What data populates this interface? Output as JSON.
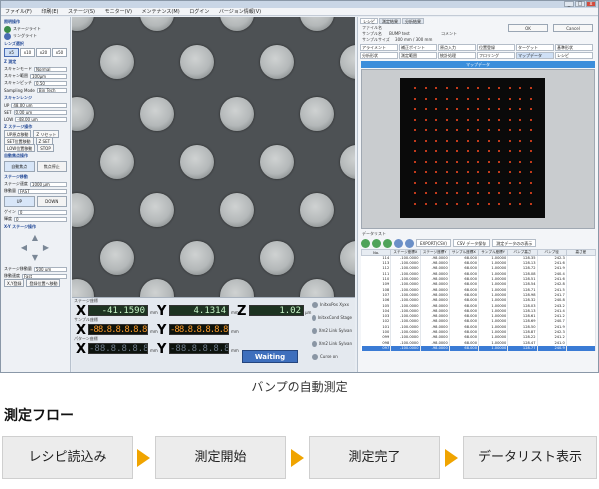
{
  "app": {
    "menu": [
      "ファイル(F)",
      "印刷(E)",
      "ステージ(S)",
      "モニター(V)",
      "メンテナンス(M)",
      "ログイン",
      "バージョン情報(V)"
    ],
    "window_controls": [
      "_",
      "□",
      "x"
    ]
  },
  "left": {
    "illumination_title": "照明操作",
    "illumination_items": [
      "ステージライト",
      "リングライト"
    ],
    "lens_title": "レンズ選択",
    "lens_options": [
      "x5",
      "x10",
      "x20",
      "x50"
    ],
    "lens_selected": "x5",
    "z_title": "Z 測定",
    "scan_mode_label": "スキャンモード",
    "scan_mode_value": "Normal",
    "scan_range_label": "スキャン範囲",
    "scan_range_value": "100μm",
    "scan_pitch_label": "スキャンピッチ",
    "scan_pitch_value": "0.50",
    "sampling_label": "Sampling Mode",
    "sampling_value": "Bin Tech",
    "limits_title": "スキャンレンジ",
    "limits_up": "UP",
    "limits_set": "SET",
    "limits_low": "LOW",
    "limits_up_val": "48.00 um",
    "limits_set_val": "0.00 um",
    "limits_low_val": "-48.00 um",
    "z_stage_title": "Z ステージ操作",
    "btn_up_origin": "UP原点移動",
    "btn_z_reset": "Z リセット",
    "btn_set_origin": "SET位置移動",
    "btn_z_set": "Z SET",
    "btn_low_origin": "LOW位置移動",
    "btn_stop": "STOP",
    "autofocus_title": "自動焦点操作",
    "btn_auto_focus": "自動焦点",
    "btn_focus_stop": "焦点停止",
    "stage_title": "ステージ移動",
    "stage_speed_label": "ステージ速度",
    "stage_speed_value": "1000 μm",
    "move_amount_label": "移動量",
    "move_amount_value": "FAST",
    "btn_up": "UP",
    "btn_down": "DOWN",
    "gain_label": "ゲイン",
    "gain_value": "0",
    "bright_label": "輝度",
    "bright_value": "0",
    "xy_title": "X-Y ステージ操作",
    "xy_speed_label": "ステージ移動量",
    "xy_speed_value": "500 um",
    "xy_move_label": "移動速度",
    "xy_move_value": "Fast",
    "btn_register": "X,Y登録",
    "btn_xy_move": "登録位置へ移動"
  },
  "readout": {
    "stage_label": "ステージ座標",
    "sample_label": "サンプル座標",
    "pattern_label": "パターン座標",
    "x_axis": "X",
    "y_axis": "Y",
    "z_axis": "Z",
    "stage_x": "-41.1590",
    "stage_y": "4.1314",
    "stage_z": "1.02",
    "sample_x": "-88.8.8.8.8.8",
    "sample_y": "-88.8.8.8.8.8",
    "pattern_x": "-88.8.8.8.8.8",
    "pattern_y": "-88.8.8.8.8.8",
    "unit_mm": "mm",
    "unit_um": "μm",
    "side_buttons": [
      "InitxxPos Xyxx",
      "InitxxCond Stage",
      "Xm2 Link Sylvan",
      "Xm2 Link Sylvan",
      "Curse on"
    ],
    "status": "Waiting"
  },
  "right": {
    "tabs": [
      "レシピ",
      "測定結果",
      "分析結果"
    ],
    "file_label": "ファイル名",
    "sample_label": "サンプル名",
    "sample_value": "BUMP test",
    "sample_size_label": "サンプルサイズ",
    "sample_size_value": "300 mm / 300 mm",
    "comment_label": "コメント",
    "ok_button": "OK",
    "cancel_button": "Cancel",
    "tools": [
      "アライメント",
      "補正ポイント",
      "原点入力",
      "位置登録",
      "ターゲット",
      "基準形状",
      "分析形状",
      "測定範囲",
      "統計処理",
      "フロリング",
      "マップデータ",
      "レシピ"
    ],
    "tools_active_index": 10,
    "map_header": "マップデータ",
    "datalist_title": "データリスト",
    "dl_buttons": [
      "EXPORT(CSV)",
      "CSV データ保存",
      "測定データのの表示"
    ],
    "table_headers": [
      "No.",
      "ステージ座標X",
      "ステージ座標Y",
      "サンプル座標X",
      "サンプル座標Y",
      "バンプ高さ",
      "バンプ径",
      "高さ差"
    ],
    "table_rows": [
      [
        "114",
        "-100.0000",
        "-98.0000",
        "68.000",
        "1.00000",
        "128.35",
        "242.3"
      ],
      [
        "113",
        "-100.0000",
        "-98.0000",
        "68.000",
        "1.00000",
        "128.13",
        "241.6"
      ],
      [
        "112",
        "-100.0000",
        "-98.0000",
        "68.000",
        "1.00000",
        "128.72",
        "241.9"
      ],
      [
        "111",
        "-100.0000",
        "-98.0000",
        "68.000",
        "1.00000",
        "128.08",
        "240.4"
      ],
      [
        "110",
        "-100.0000",
        "-98.0000",
        "68.000",
        "1.00000",
        "128.51",
        "241.6"
      ],
      [
        "109",
        "-100.0000",
        "-98.0000",
        "68.000",
        "1.00000",
        "128.54",
        "242.8"
      ],
      [
        "108",
        "-100.0000",
        "-98.0000",
        "68.000",
        "1.00000",
        "128.71",
        "241.5"
      ],
      [
        "107",
        "-100.0000",
        "-98.0000",
        "68.000",
        "1.00000",
        "128.98",
        "241.7"
      ],
      [
        "106",
        "-100.0000",
        "-98.0000",
        "68.000",
        "1.00000",
        "128.32",
        "240.8"
      ],
      [
        "105",
        "-100.0000",
        "-98.0000",
        "68.000",
        "1.00000",
        "128.03",
        "243.2"
      ],
      [
        "104",
        "-100.0000",
        "-98.0000",
        "68.000",
        "1.00000",
        "128.13",
        "241.4"
      ],
      [
        "103",
        "-100.0000",
        "-98.0000",
        "68.000",
        "1.00000",
        "128.61",
        "241.2"
      ],
      [
        "102",
        "-100.0000",
        "-98.0000",
        "68.000",
        "1.00000",
        "128.69",
        "240.7"
      ],
      [
        "101",
        "-100.0000",
        "-98.0000",
        "68.000",
        "1.00000",
        "128.50",
        "241.9"
      ],
      [
        "100",
        "-100.0000",
        "-98.0000",
        "68.000",
        "1.00000",
        "128.87",
        "242.3"
      ],
      [
        "099",
        "-100.0000",
        "-98.0000",
        "68.000",
        "1.00000",
        "128.22",
        "241.2"
      ],
      [
        "098",
        "-100.0000",
        "-98.0000",
        "68.000",
        "1.00000",
        "128.47",
        "241.0"
      ],
      [
        "097",
        "-100.0000",
        "-98.0000",
        "68.000",
        "1.00000",
        "128.77",
        "240.9"
      ]
    ],
    "selected_row_index": 17
  },
  "caption": "バンプの自動測定",
  "flow": {
    "title": "測定フロー",
    "steps": [
      "レシピ読込み",
      "測定開始",
      "測定完了",
      "データリスト表示"
    ],
    "arrow_color": "#f0a400"
  }
}
